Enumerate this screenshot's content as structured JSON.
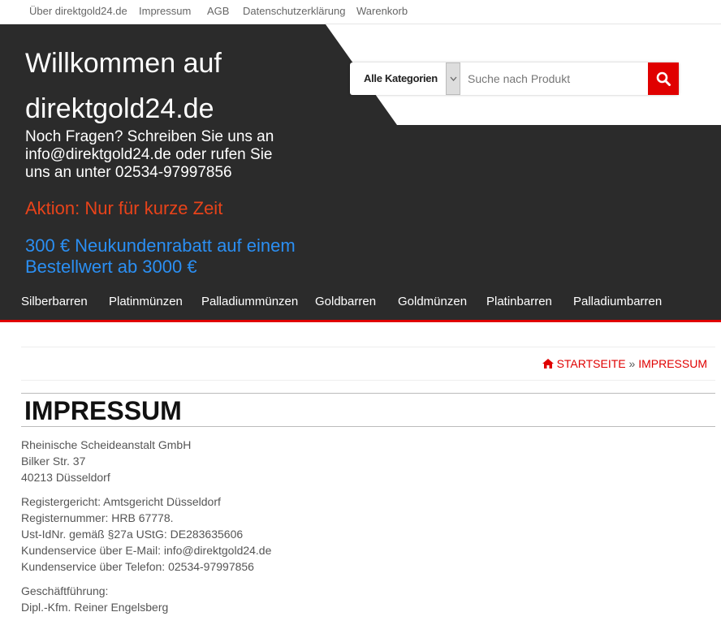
{
  "topbar": {
    "links": [
      "Über direktgold24.de",
      "Impressum",
      "AGB",
      "Datenschutzerklärung",
      "Warenkorb"
    ]
  },
  "header": {
    "welcome_line1": "Willkommen auf",
    "welcome_line2": "direktgold24.de",
    "contact": "Noch Fragen? Schreiben Sie uns an info@direktgold24.de oder rufen Sie uns an unter 02534-97997856",
    "aktion": "Aktion: Nur für kurze Zeit",
    "rabatt": "300 € Neukundenrabatt auf einem Bestellwert ab 3000 €",
    "colors": {
      "background": "#2b2b2b",
      "aktion": "#e8431a",
      "rabatt": "#2b8ff3",
      "accent": "#e00000"
    }
  },
  "search": {
    "category_label": "Alle Kategorien",
    "placeholder": "Suche nach Produkt",
    "icon": "search-icon"
  },
  "nav": {
    "items": [
      "Silberbarren",
      "Platinmünzen",
      "Palladiummünzen",
      "Goldbarren",
      "Goldmünzen",
      "Platinbarren",
      "Palladiumbarren"
    ]
  },
  "breadcrumb": {
    "home_icon": "home-icon",
    "home": "STARTSEITE",
    "separator": "»",
    "current": "IMPRESSUM"
  },
  "page": {
    "title": "IMPRESSUM",
    "address": [
      "Rheinische Scheideanstalt GmbH",
      "Bilker Str. 37",
      "40213 Düsseldorf"
    ],
    "register": [
      "Registergericht: Amtsgericht Düsseldorf",
      "Registernummer: HRB 67778.",
      "Ust-IdNr. gemäß §27a UStG: DE283635606",
      "Kundenservice über E-Mail: info@direktgold24.de",
      "Kundenservice über Telefon: 02534-97997856"
    ],
    "management": [
      "Geschäftführung:",
      "Dipl.-Kfm. Reiner Engelsberg"
    ]
  }
}
